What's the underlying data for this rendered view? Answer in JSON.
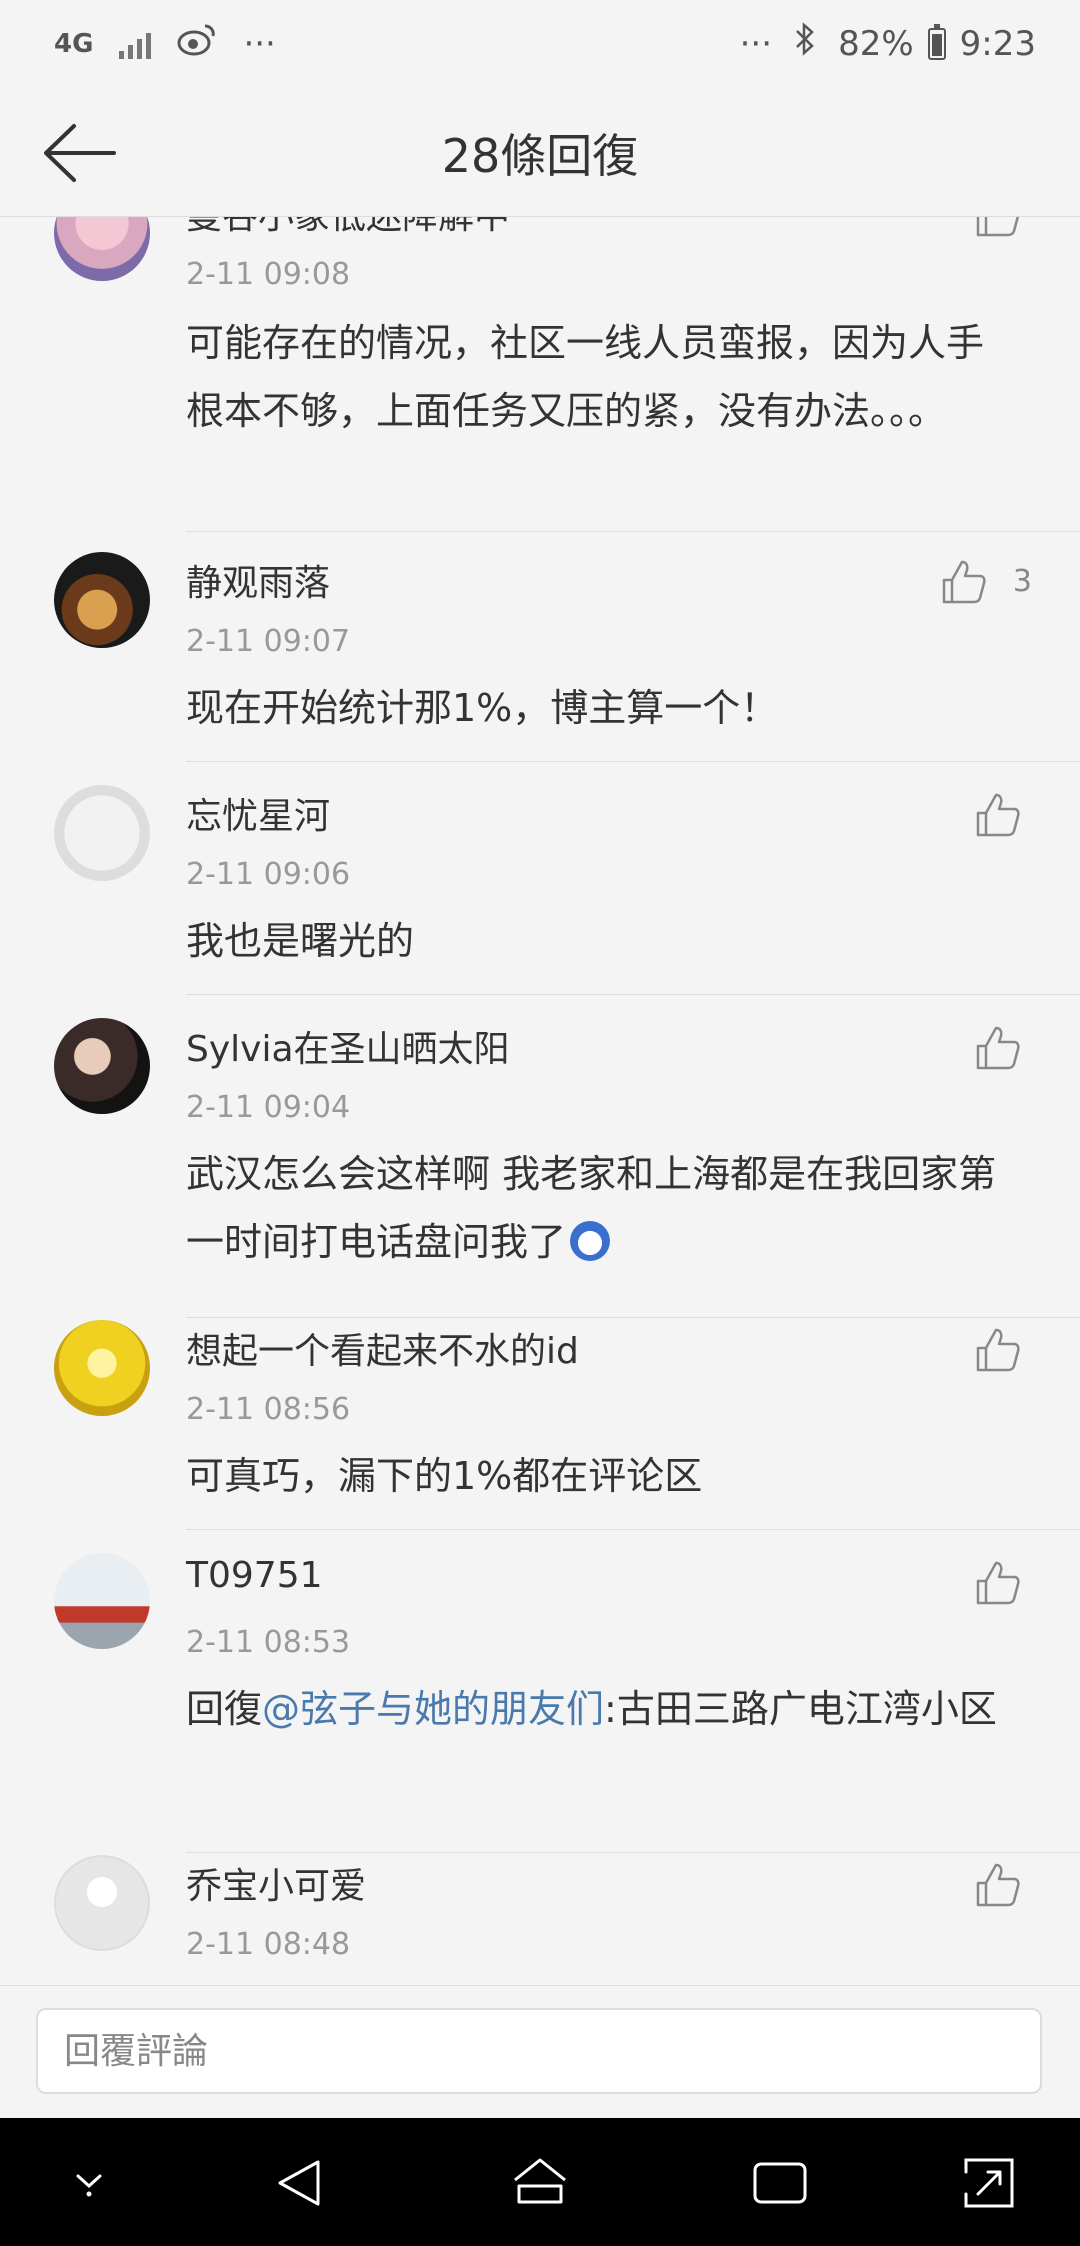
{
  "status": {
    "network": "4G",
    "extra_left": "···",
    "extra_right": "···",
    "battery": "82%",
    "time": "9:23"
  },
  "header": {
    "title": "28條回復"
  },
  "comments": [
    {
      "name": "曼谷小象低迷降解中",
      "time": "2-11 09:08",
      "text": "可能存在的情况，社区一线人员蛮报，因为人手根本不够，上面任务又压的紧，没有办法。。。",
      "likes": ""
    },
    {
      "name": "静观雨落",
      "time": "2-11 09:07",
      "text": "现在开始统计那1%，博主算一个！",
      "likes": "3"
    },
    {
      "name": "忘忧星河",
      "time": "2-11 09:06",
      "text": "我也是曙光的",
      "likes": ""
    },
    {
      "name": "Sylvia在圣山晒太阳",
      "time": "2-11 09:04",
      "text": "武汉怎么会这样啊 我老家和上海都是在我回家第一时间打电话盘问我了",
      "likes": ""
    },
    {
      "name": "想起一个看起来不水的id",
      "time": "2-11 08:56",
      "text": "可真巧，漏下的1%都在评论区",
      "likes": ""
    },
    {
      "name": "T09751",
      "time": "2-11 08:53",
      "reply_prefix": "回復",
      "mention": "@弦子与她的朋友们",
      "text": ":古田三路广电江湾小区",
      "likes": ""
    },
    {
      "name": "乔宝小可爱",
      "time": "2-11 08:48",
      "text": "",
      "likes": ""
    }
  ],
  "reply": {
    "placeholder": "回覆評論"
  },
  "colors": {
    "background": "#f4f4f4",
    "mention": "#4a7aad",
    "nav": "#000000"
  }
}
